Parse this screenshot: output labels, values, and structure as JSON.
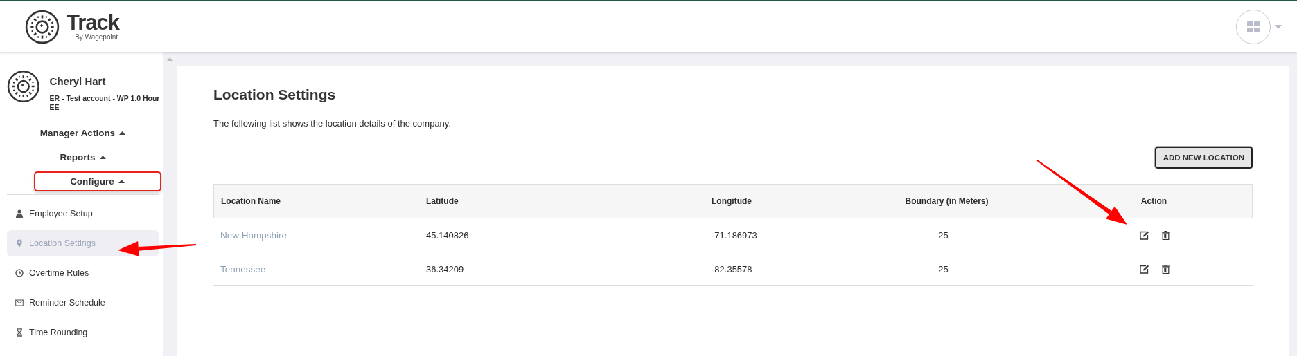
{
  "header": {
    "brand": "Track",
    "tagline": "By Wagepoint"
  },
  "user": {
    "name": "Cheryl Hart",
    "account": "ER - Test account - WP 1.0 Hour",
    "role": "EE"
  },
  "menu_groups": [
    {
      "label": "Manager Actions",
      "expanded": true,
      "annotated": false
    },
    {
      "label": "Reports",
      "expanded": true,
      "annotated": false
    },
    {
      "label": "Configure",
      "expanded": true,
      "annotated": true
    }
  ],
  "sidebar": {
    "items": [
      {
        "label": "Employee Setup",
        "selected": false
      },
      {
        "label": "Location Settings",
        "selected": true
      },
      {
        "label": "Overtime Rules",
        "selected": false
      },
      {
        "label": "Reminder Schedule",
        "selected": false
      },
      {
        "label": "Time Rounding",
        "selected": false
      }
    ]
  },
  "page": {
    "title": "Location Settings",
    "description": "The following list shows the location details of the company.",
    "add_button": "ADD NEW LOCATION"
  },
  "table": {
    "columns": [
      "Location Name",
      "Latitude",
      "Longitude",
      "Boundary (in Meters)",
      "Action"
    ],
    "rows": [
      {
        "name": "New Hampshire",
        "latitude": "45.140826",
        "longitude": "-71.186973",
        "boundary": "25"
      },
      {
        "name": "Tennessee",
        "latitude": "36.34209",
        "longitude": "-82.35578",
        "boundary": "25"
      }
    ]
  },
  "annotations": [
    {
      "kind": "arrow"
    },
    {
      "kind": "arrow"
    }
  ]
}
